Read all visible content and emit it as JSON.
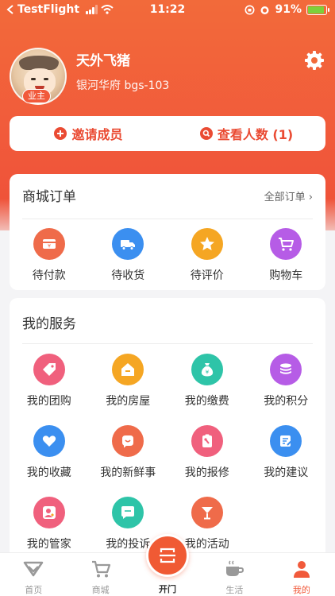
{
  "status_bar": {
    "carrier": "TestFlight",
    "time": "11:22",
    "battery": "91%",
    "battery_level": 0.91
  },
  "profile": {
    "name": "天外飞猪",
    "address": "银河华府 bgs-103",
    "role_badge": "业主"
  },
  "actions": [
    {
      "label": "邀请成员",
      "icon": "plus-icon"
    },
    {
      "label": "查看人数 (1)",
      "icon": "search-icon"
    }
  ],
  "orders": {
    "title": "商城订单",
    "link": "全部订单",
    "items": [
      {
        "label": "待付款",
        "icon": "wallet-icon",
        "color": "#ef6b4a"
      },
      {
        "label": "待收货",
        "icon": "truck-icon",
        "color": "#3b8ff0"
      },
      {
        "label": "待评价",
        "icon": "star-icon",
        "color": "#f5a623"
      },
      {
        "label": "购物车",
        "icon": "cart-icon",
        "color": "#b65ce6"
      }
    ]
  },
  "services": {
    "title": "我的服务",
    "items": [
      {
        "label": "我的团购",
        "icon": "tag-icon",
        "color": "#f0607d"
      },
      {
        "label": "我的房屋",
        "icon": "house-icon",
        "color": "#f5a623"
      },
      {
        "label": "我的缴费",
        "icon": "money-bag-icon",
        "color": "#2ec4a8"
      },
      {
        "label": "我的积分",
        "icon": "coins-icon",
        "color": "#b65ce6"
      },
      {
        "label": "我的收藏",
        "icon": "heart-icon",
        "color": "#3b8ff0"
      },
      {
        "label": "我的新鲜事",
        "icon": "smile-icon",
        "color": "#ef6b4a"
      },
      {
        "label": "我的报修",
        "icon": "repair-icon",
        "color": "#f0607d"
      },
      {
        "label": "我的建议",
        "icon": "edit-icon",
        "color": "#3b8ff0"
      },
      {
        "label": "我的管家",
        "icon": "butler-icon",
        "color": "#f0607d"
      },
      {
        "label": "我的投诉",
        "icon": "chat-icon",
        "color": "#2ec4a8"
      },
      {
        "label": "我的活动",
        "icon": "cocktail-icon",
        "color": "#ef6b4a"
      }
    ]
  },
  "tabbar": {
    "items": [
      {
        "label": "首页",
        "icon": "home-logo-icon",
        "active": false
      },
      {
        "label": "商城",
        "icon": "cart-icon",
        "active": false
      },
      {
        "label": "开门",
        "icon": "scan-door-icon",
        "active": false
      },
      {
        "label": "生活",
        "icon": "coffee-icon",
        "active": false
      },
      {
        "label": "我的",
        "icon": "person-icon",
        "active": true
      }
    ]
  },
  "colors": {
    "brand": "#f15a3b",
    "accent_text": "#ea4b33"
  }
}
